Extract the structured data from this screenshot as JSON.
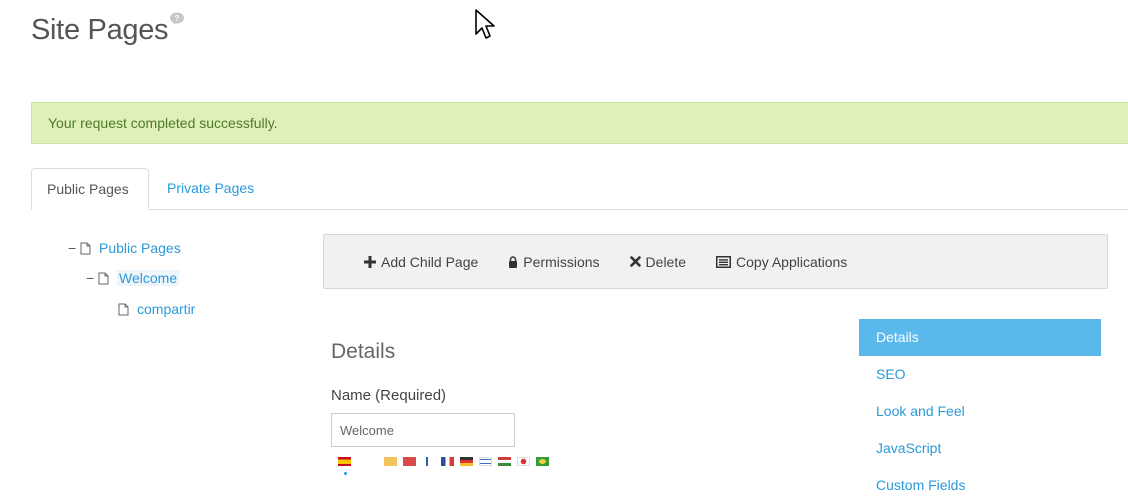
{
  "page": {
    "title": "Site Pages"
  },
  "alert": {
    "message": "Your request completed successfully."
  },
  "tabs": [
    {
      "label": "Public Pages",
      "active": true
    },
    {
      "label": "Private Pages",
      "active": false
    }
  ],
  "tree": {
    "root": {
      "label": "Public Pages"
    },
    "child": {
      "label": "Welcome",
      "selected": true
    },
    "grandchild": {
      "label": "compartir"
    }
  },
  "toolbar": {
    "add_child_page": "Add Child Page",
    "permissions": "Permissions",
    "delete": "Delete",
    "copy_applications": "Copy Applications"
  },
  "details": {
    "section_title": "Details",
    "name_label": "Name (Required)",
    "name_value": "Welcome"
  },
  "side_nav": {
    "items": [
      {
        "label": "Details",
        "active": true
      },
      {
        "label": "SEO",
        "active": false
      },
      {
        "label": "Look and Feel",
        "active": false
      },
      {
        "label": "JavaScript",
        "active": false
      },
      {
        "label": "Custom Fields",
        "active": false
      }
    ]
  },
  "colors": {
    "link": "#2b9ad9",
    "alert_bg": "#dff0b8",
    "alert_text": "#4f7a28",
    "nav_active": "#5bb8ea"
  }
}
